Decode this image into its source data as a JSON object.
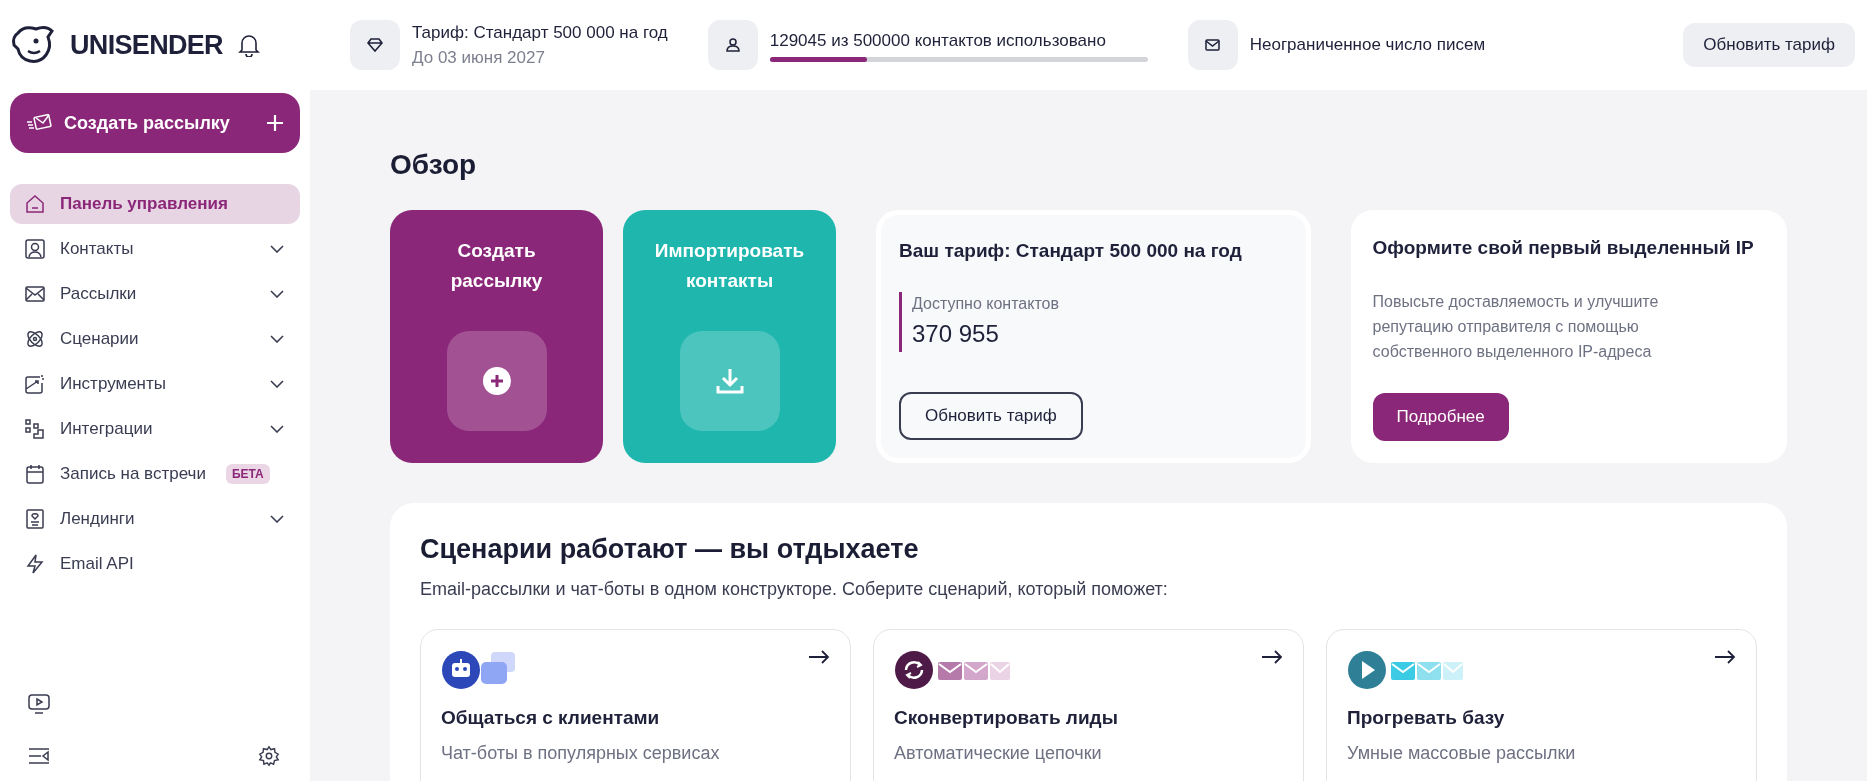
{
  "brand": "UNISENDER",
  "top_bar": {
    "plan": {
      "title": "Тариф: Стандарт 500 000 на год",
      "subtitle": "До 03 июня 2027"
    },
    "contacts": {
      "text": "129045 из 500000 контактов использовано",
      "level": 0.258
    },
    "letters": {
      "text": "Неограниченное число писем"
    },
    "upgrade_button": "Обновить тариф"
  },
  "sidebar": {
    "create_button": "Создать рассылку",
    "items": [
      {
        "label": "Панель управления",
        "selected": true,
        "expandable": false
      },
      {
        "label": "Контакты",
        "selected": false,
        "expandable": true
      },
      {
        "label": "Рассылки",
        "selected": false,
        "expandable": true
      },
      {
        "label": "Сценарии",
        "selected": false,
        "expandable": true
      },
      {
        "label": "Инструменты",
        "selected": false,
        "expandable": true
      },
      {
        "label": "Интеграции",
        "selected": false,
        "expandable": true
      },
      {
        "label": "Запись на встречи",
        "selected": false,
        "expandable": false,
        "badge": "БЕТА"
      },
      {
        "label": "Лендинги",
        "selected": false,
        "expandable": true
      },
      {
        "label": "Email API",
        "selected": false,
        "expandable": false
      }
    ]
  },
  "overview": {
    "title": "Обзор",
    "actions": [
      {
        "label": "Создать рассылку",
        "kind": "create"
      },
      {
        "label": "Импортировать контакты",
        "kind": "import"
      }
    ],
    "plan_card": {
      "title": "Ваш тариф: Стандарт 500 000 на год",
      "stat_label": "Доступно контактов",
      "stat_value": "370 955",
      "button": "Обновить тариф"
    },
    "ip_card": {
      "title": "Оформите свой первый выделенный IP",
      "text": "Повысьте доставляемость и улучшите репутацию отправителя с помощью собственного выделенного IP-адреса",
      "button": "Подробнее"
    }
  },
  "scenarios": {
    "title": "Сценарии работают — вы отдыхаете",
    "subtitle": "Email-рассылки и чат-боты в одном конструкторе. Соберите сценарий, который поможет:",
    "cards": [
      {
        "kind": "chat",
        "title": "Общаться с клиентами",
        "text": "Чат-боты в популярных сервисах"
      },
      {
        "kind": "convert",
        "title": "Сконвертировать лиды",
        "text": "Автоматические цепочки"
      },
      {
        "kind": "warm",
        "title": "Прогревать базу",
        "text": "Умные массовые рассылки"
      }
    ]
  }
}
